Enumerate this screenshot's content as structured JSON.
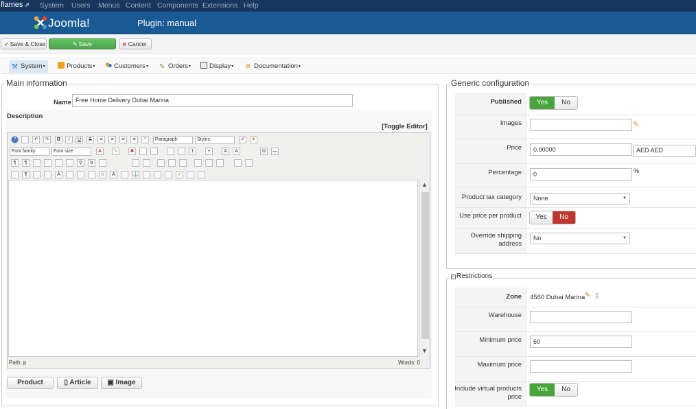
{
  "topbar": {
    "site": "flames",
    "menu": [
      "System",
      "Users",
      "Menus",
      "Content",
      "Components",
      "Extensions",
      "Help"
    ]
  },
  "header": {
    "logo_text": "Joomla!",
    "title": "Plugin: manual"
  },
  "toolbar": {
    "save_close": "Save & Close",
    "save": "Save",
    "cancel": "Cancel"
  },
  "hikamenu": [
    {
      "label": "System",
      "icon": "system-icon"
    },
    {
      "label": "Products",
      "icon": "products-icon"
    },
    {
      "label": "Customers",
      "icon": "customers-icon"
    },
    {
      "label": "Orders",
      "icon": "orders-icon"
    },
    {
      "label": "Display",
      "icon": "display-icon"
    },
    {
      "label": "Documentation",
      "icon": "documentation-icon"
    }
  ],
  "main_info": {
    "legend": "Main information",
    "name_label": "Name",
    "name_value": "Free Home Delivery Dubai Marina",
    "description_label": "Description",
    "toggle_editor": "[Toggle Editor]",
    "editor": {
      "paragraph": "Paragraph",
      "styles": "Styles",
      "font_family": "Font family",
      "font_size": "Font size",
      "path_label": "Path:",
      "path_value": "p",
      "words": "Words: 0"
    },
    "buttons": {
      "product": "Product",
      "article": "Article",
      "image": "Image"
    }
  },
  "generic": {
    "legend": "Generic configuration",
    "published_label": "Published",
    "yes": "Yes",
    "no": "No",
    "images_label": "Images",
    "price_label": "Price",
    "price_value": "0.00000",
    "currency": "AED AED",
    "percentage_label": "Percentage",
    "percentage_value": "0",
    "percent_sign": "%",
    "tax_label": "Product tax category",
    "tax_value": "None",
    "per_product_label": "Use price per product",
    "override_label": "Override shipping address",
    "override_value": "No"
  },
  "restrictions": {
    "legend": "Restrictions",
    "zone_label": "Zone",
    "zone_value": "4560 Dubai Marina",
    "warehouse_label": "Warehouse",
    "min_price_label": "Minimum price",
    "min_price_value": "60",
    "max_price_label": "Maximum price",
    "virtual_label": "Include virtual products price"
  },
  "colors": {
    "topbar": "#17375e",
    "header": "#1a5a94",
    "save_green": "#51a351",
    "yes_green": "#48a53a",
    "no_red": "#bd362f"
  }
}
